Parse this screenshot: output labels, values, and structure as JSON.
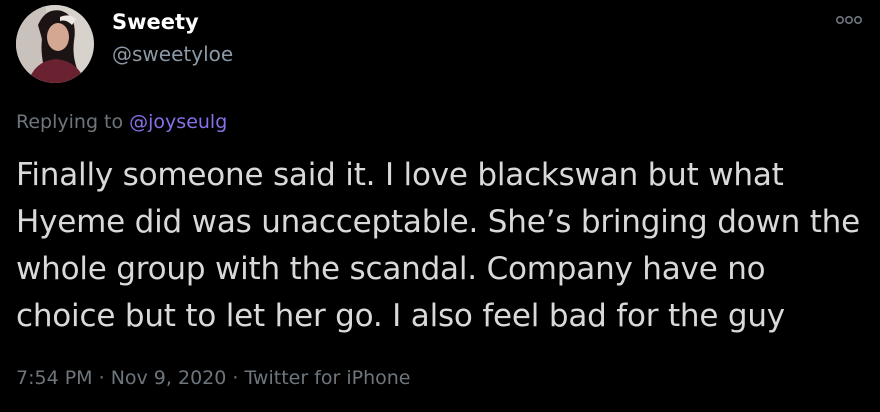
{
  "user": {
    "display_name": "Sweety",
    "handle": "@sweetyloe"
  },
  "reply": {
    "prefix": "Replying to ",
    "mention": "@joyseulg"
  },
  "tweet": {
    "text": "Finally someone said it. I love blackswan but what Hyeme did was unacceptable. She’s bringing down the whole group with the scandal. Company have no choice but to let her go. I also feel bad for the guy"
  },
  "meta": {
    "time": "7:54 PM",
    "separator": " · ",
    "date": "Nov 9, 2020",
    "source": "Twitter for iPhone"
  },
  "icons": {
    "more": "more-options-icon",
    "avatar": "profile-avatar"
  },
  "colors": {
    "background": "#000000",
    "text": "#d9d9d9",
    "secondary": "#6e767d",
    "mention": "#8a6fe8"
  }
}
